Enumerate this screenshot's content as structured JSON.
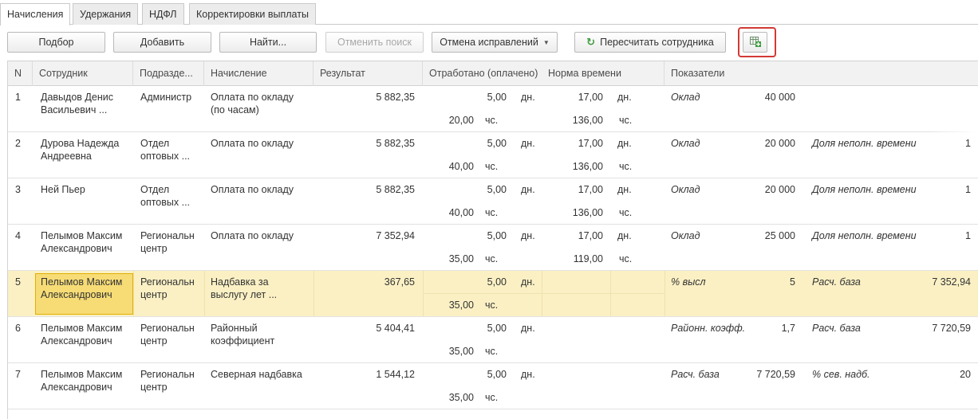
{
  "tabs": [
    {
      "label": "Начисления",
      "active": true
    },
    {
      "label": "Удержания",
      "active": false
    },
    {
      "label": "НДФЛ",
      "active": false
    },
    {
      "label": "Корректировки выплаты",
      "active": false
    }
  ],
  "toolbar": {
    "select": "Подбор",
    "add": "Добавить",
    "find": "Найти...",
    "cancel_search": "Отменить поиск",
    "cancel_corrections": "Отмена исправлений",
    "recalculate": "Пересчитать сотрудника",
    "icon_button": "table-add-icon"
  },
  "columns": {
    "n": "N",
    "employee": "Сотрудник",
    "department": "Подразде...",
    "accrual": "Начисление",
    "result": "Результат",
    "worked": "Отработано (оплачено)",
    "norm": "Норма времени",
    "indicators": "Показатели"
  },
  "rows": [
    {
      "n": "1",
      "emp1": "Давыдов Денис",
      "emp2": "Васильевич ...",
      "dep1": "Администр",
      "dep2": "",
      "acc1": "Оплата по окладу",
      "acc2": "(по часам)",
      "result": "5 882,35",
      "days": "5,00",
      "days_unit": "дн.",
      "hours": "20,00",
      "hours_unit": "чс.",
      "norm_days": "17,00",
      "norm_days_unit": "дн.",
      "norm_hours": "136,00",
      "norm_hours_unit": "чс.",
      "ind1_name": "Оклад",
      "ind1_val": "40 000",
      "ind2_name": "",
      "ind2_val": ""
    },
    {
      "n": "2",
      "emp1": "Дурова Надежда",
      "emp2": "Андреевна",
      "dep1": "Отдел",
      "dep2": "оптовых ...",
      "acc1": "Оплата по окладу",
      "acc2": "",
      "result": "5 882,35",
      "days": "5,00",
      "days_unit": "дн.",
      "hours": "40,00",
      "hours_unit": "чс.",
      "norm_days": "17,00",
      "norm_days_unit": "дн.",
      "norm_hours": "136,00",
      "norm_hours_unit": "чс.",
      "ind1_name": "Оклад",
      "ind1_val": "20 000",
      "ind2_name": "Доля неполн. времени",
      "ind2_val": "1"
    },
    {
      "n": "3",
      "emp1": "Ней Пьер",
      "emp2": "",
      "dep1": "Отдел",
      "dep2": "оптовых ...",
      "acc1": "Оплата по окладу",
      "acc2": "",
      "result": "5 882,35",
      "days": "5,00",
      "days_unit": "дн.",
      "hours": "40,00",
      "hours_unit": "чс.",
      "norm_days": "17,00",
      "norm_days_unit": "дн.",
      "norm_hours": "136,00",
      "norm_hours_unit": "чс.",
      "ind1_name": "Оклад",
      "ind1_val": "20 000",
      "ind2_name": "Доля неполн. времени",
      "ind2_val": "1"
    },
    {
      "n": "4",
      "emp1": "Пелымов Максим",
      "emp2": "Александрович",
      "dep1": "Региональн",
      "dep2": "центр",
      "acc1": "Оплата по окладу",
      "acc2": "",
      "result": "7 352,94",
      "days": "5,00",
      "days_unit": "дн.",
      "hours": "35,00",
      "hours_unit": "чс.",
      "norm_days": "17,00",
      "norm_days_unit": "дн.",
      "norm_hours": "119,00",
      "norm_hours_unit": "чс.",
      "ind1_name": "Оклад",
      "ind1_val": "25 000",
      "ind2_name": "Доля неполн. времени",
      "ind2_val": "1"
    },
    {
      "n": "5",
      "emp1": "Пелымов Максим",
      "emp2": "Александрович",
      "dep1": "Региональн",
      "dep2": "центр",
      "acc1": "Надбавка за",
      "acc2": "выслугу лет ...",
      "result": "367,65",
      "days": "5,00",
      "days_unit": "дн.",
      "hours": "35,00",
      "hours_unit": "чс.",
      "norm_days": "",
      "norm_days_unit": "",
      "norm_hours": "",
      "norm_hours_unit": "",
      "ind1_name": "% высл",
      "ind1_val": "5",
      "ind2_name": "Расч. база",
      "ind2_val": "7 352,94",
      "selected": true
    },
    {
      "n": "6",
      "emp1": "Пелымов Максим",
      "emp2": "Александрович",
      "dep1": "Региональн",
      "dep2": "центр",
      "acc1": "Районный",
      "acc2": "коэффициент",
      "result": "5 404,41",
      "days": "5,00",
      "days_unit": "дн.",
      "hours": "35,00",
      "hours_unit": "чс.",
      "norm_days": "",
      "norm_days_unit": "",
      "norm_hours": "",
      "norm_hours_unit": "",
      "ind1_name": "Районн. коэфф.",
      "ind1_val": "1,7",
      "ind2_name": "Расч. база",
      "ind2_val": "7 720,59"
    },
    {
      "n": "7",
      "emp1": "Пелымов Максим",
      "emp2": "Александрович",
      "dep1": "Региональн",
      "dep2": "центр",
      "acc1": "Северная надбавка",
      "acc2": "",
      "result": "1 544,12",
      "days": "5,00",
      "days_unit": "дн.",
      "hours": "35,00",
      "hours_unit": "чс.",
      "norm_days": "",
      "norm_days_unit": "",
      "norm_hours": "",
      "norm_hours_unit": "",
      "ind1_name": "Расч. база",
      "ind1_val": "7 720,59",
      "ind2_name": "% сев. надб.",
      "ind2_val": "20"
    }
  ],
  "colors": {
    "selected_row": "#fbf0c4",
    "focused_cell": "#f7dc76",
    "highlight_border": "#d23a35",
    "refresh_icon": "#3f9b3f"
  }
}
